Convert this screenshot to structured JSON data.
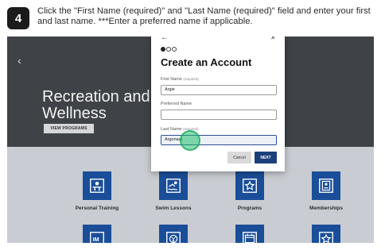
{
  "instruction": {
    "step": "4",
    "text": "Click the \"First Name (required)\" and \"Last Name (required)\" field and enter your first and last name. ***Enter a preferred name if applicable."
  },
  "hero": {
    "title_line1": "Recreation and",
    "title_line2": "Wellness",
    "button": "VIEW PROGRAMS"
  },
  "tiles": [
    {
      "label": "Personal Training",
      "icon": "trainer-icon"
    },
    {
      "label": "Swim Lessons",
      "icon": "swimmer-icon"
    },
    {
      "label": "Programs",
      "icon": "star-icon"
    },
    {
      "label": "Memberships",
      "icon": "id-card-icon"
    },
    {
      "label": "",
      "icon": "im-icon"
    },
    {
      "label": "",
      "icon": "ball-icon"
    },
    {
      "label": "",
      "icon": "calendar-icon"
    },
    {
      "label": "",
      "icon": "badge-icon"
    }
  ],
  "modal": {
    "title": "Create an Account",
    "steps_total": 3,
    "step_current": 1,
    "first_name_label": "First Name",
    "first_name_req": "(required)",
    "first_name_value": "Argie",
    "preferred_label": "Preferred Name",
    "preferred_value": "",
    "last_name_label": "Last Name",
    "last_name_req": "(required)",
    "last_name_value": "Argonaut",
    "cancel": "Cancel",
    "next": "NEXT"
  },
  "colors": {
    "tile_blue": "#1a4e98",
    "next_blue": "#1b3f7a",
    "click_marker": "#22be6e"
  }
}
